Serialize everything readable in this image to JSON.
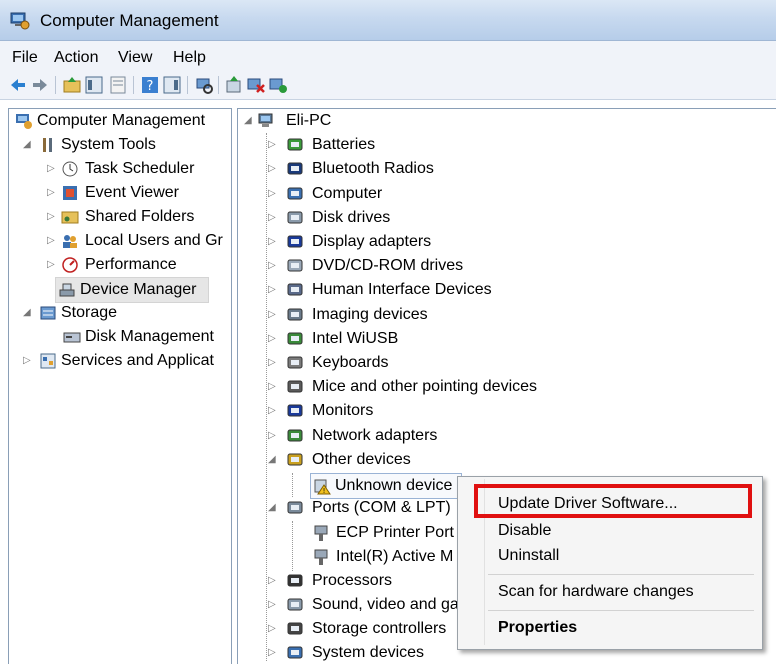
{
  "window": {
    "title": "Computer Management"
  },
  "menu": [
    "File",
    "Action",
    "View",
    "Help"
  ],
  "left_tree": {
    "root": "Computer Management",
    "system_tools": "System Tools",
    "task_scheduler": "Task Scheduler",
    "event_viewer": "Event Viewer",
    "shared_folders": "Shared Folders",
    "local_users": "Local Users and Gr",
    "performance": "Performance",
    "device_manager": "Device Manager",
    "storage": "Storage",
    "disk_management": "Disk Management",
    "services": "Services and Applicat"
  },
  "device_tree": {
    "root": "Eli-PC",
    "items": [
      "Batteries",
      "Bluetooth Radios",
      "Computer",
      "Disk drives",
      "Display adapters",
      "DVD/CD-ROM drives",
      "Human Interface Devices",
      "Imaging devices",
      "Intel WiUSB",
      "Keyboards",
      "Mice and other pointing devices",
      "Monitors",
      "Network adapters",
      "Other devices",
      "Unknown device",
      "Ports (COM & LPT)",
      "ECP Printer Port",
      "Intel(R) Active M",
      "Processors",
      "Sound, video and ga",
      "Storage controllers",
      "System devices"
    ]
  },
  "context_menu": {
    "update": "Update Driver Software...",
    "disable": "Disable",
    "uninstall": "Uninstall",
    "scan": "Scan for hardware changes",
    "properties": "Properties"
  },
  "colors": {
    "highlight": "#e01010",
    "titlebar": "#c7d9ef"
  }
}
